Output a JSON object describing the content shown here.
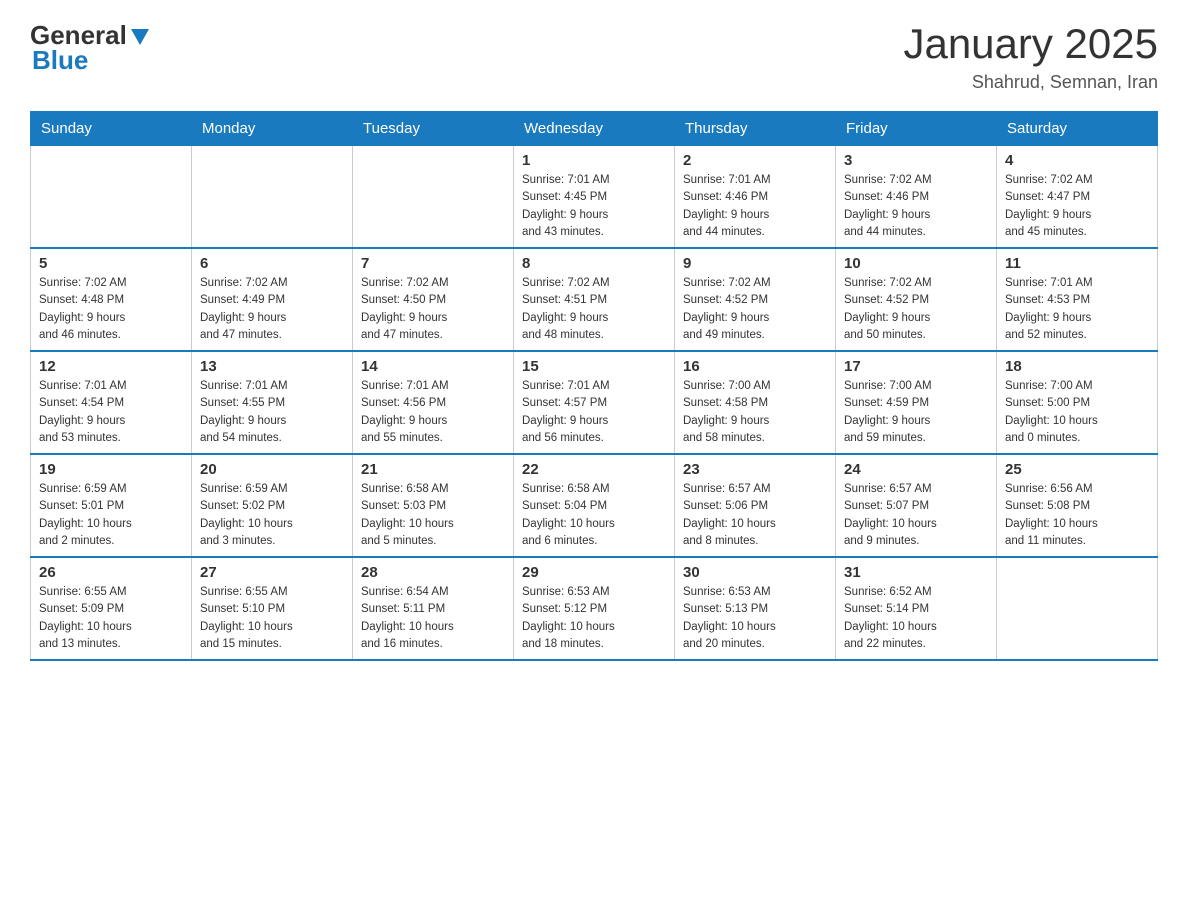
{
  "header": {
    "logo": {
      "general": "General",
      "blue": "Blue"
    },
    "title": "January 2025",
    "subtitle": "Shahrud, Semnan, Iran"
  },
  "days_of_week": [
    "Sunday",
    "Monday",
    "Tuesday",
    "Wednesday",
    "Thursday",
    "Friday",
    "Saturday"
  ],
  "weeks": [
    [
      {
        "day": "",
        "info": ""
      },
      {
        "day": "",
        "info": ""
      },
      {
        "day": "",
        "info": ""
      },
      {
        "day": "1",
        "info": "Sunrise: 7:01 AM\nSunset: 4:45 PM\nDaylight: 9 hours\nand 43 minutes."
      },
      {
        "day": "2",
        "info": "Sunrise: 7:01 AM\nSunset: 4:46 PM\nDaylight: 9 hours\nand 44 minutes."
      },
      {
        "day": "3",
        "info": "Sunrise: 7:02 AM\nSunset: 4:46 PM\nDaylight: 9 hours\nand 44 minutes."
      },
      {
        "day": "4",
        "info": "Sunrise: 7:02 AM\nSunset: 4:47 PM\nDaylight: 9 hours\nand 45 minutes."
      }
    ],
    [
      {
        "day": "5",
        "info": "Sunrise: 7:02 AM\nSunset: 4:48 PM\nDaylight: 9 hours\nand 46 minutes."
      },
      {
        "day": "6",
        "info": "Sunrise: 7:02 AM\nSunset: 4:49 PM\nDaylight: 9 hours\nand 47 minutes."
      },
      {
        "day": "7",
        "info": "Sunrise: 7:02 AM\nSunset: 4:50 PM\nDaylight: 9 hours\nand 47 minutes."
      },
      {
        "day": "8",
        "info": "Sunrise: 7:02 AM\nSunset: 4:51 PM\nDaylight: 9 hours\nand 48 minutes."
      },
      {
        "day": "9",
        "info": "Sunrise: 7:02 AM\nSunset: 4:52 PM\nDaylight: 9 hours\nand 49 minutes."
      },
      {
        "day": "10",
        "info": "Sunrise: 7:02 AM\nSunset: 4:52 PM\nDaylight: 9 hours\nand 50 minutes."
      },
      {
        "day": "11",
        "info": "Sunrise: 7:01 AM\nSunset: 4:53 PM\nDaylight: 9 hours\nand 52 minutes."
      }
    ],
    [
      {
        "day": "12",
        "info": "Sunrise: 7:01 AM\nSunset: 4:54 PM\nDaylight: 9 hours\nand 53 minutes."
      },
      {
        "day": "13",
        "info": "Sunrise: 7:01 AM\nSunset: 4:55 PM\nDaylight: 9 hours\nand 54 minutes."
      },
      {
        "day": "14",
        "info": "Sunrise: 7:01 AM\nSunset: 4:56 PM\nDaylight: 9 hours\nand 55 minutes."
      },
      {
        "day": "15",
        "info": "Sunrise: 7:01 AM\nSunset: 4:57 PM\nDaylight: 9 hours\nand 56 minutes."
      },
      {
        "day": "16",
        "info": "Sunrise: 7:00 AM\nSunset: 4:58 PM\nDaylight: 9 hours\nand 58 minutes."
      },
      {
        "day": "17",
        "info": "Sunrise: 7:00 AM\nSunset: 4:59 PM\nDaylight: 9 hours\nand 59 minutes."
      },
      {
        "day": "18",
        "info": "Sunrise: 7:00 AM\nSunset: 5:00 PM\nDaylight: 10 hours\nand 0 minutes."
      }
    ],
    [
      {
        "day": "19",
        "info": "Sunrise: 6:59 AM\nSunset: 5:01 PM\nDaylight: 10 hours\nand 2 minutes."
      },
      {
        "day": "20",
        "info": "Sunrise: 6:59 AM\nSunset: 5:02 PM\nDaylight: 10 hours\nand 3 minutes."
      },
      {
        "day": "21",
        "info": "Sunrise: 6:58 AM\nSunset: 5:03 PM\nDaylight: 10 hours\nand 5 minutes."
      },
      {
        "day": "22",
        "info": "Sunrise: 6:58 AM\nSunset: 5:04 PM\nDaylight: 10 hours\nand 6 minutes."
      },
      {
        "day": "23",
        "info": "Sunrise: 6:57 AM\nSunset: 5:06 PM\nDaylight: 10 hours\nand 8 minutes."
      },
      {
        "day": "24",
        "info": "Sunrise: 6:57 AM\nSunset: 5:07 PM\nDaylight: 10 hours\nand 9 minutes."
      },
      {
        "day": "25",
        "info": "Sunrise: 6:56 AM\nSunset: 5:08 PM\nDaylight: 10 hours\nand 11 minutes."
      }
    ],
    [
      {
        "day": "26",
        "info": "Sunrise: 6:55 AM\nSunset: 5:09 PM\nDaylight: 10 hours\nand 13 minutes."
      },
      {
        "day": "27",
        "info": "Sunrise: 6:55 AM\nSunset: 5:10 PM\nDaylight: 10 hours\nand 15 minutes."
      },
      {
        "day": "28",
        "info": "Sunrise: 6:54 AM\nSunset: 5:11 PM\nDaylight: 10 hours\nand 16 minutes."
      },
      {
        "day": "29",
        "info": "Sunrise: 6:53 AM\nSunset: 5:12 PM\nDaylight: 10 hours\nand 18 minutes."
      },
      {
        "day": "30",
        "info": "Sunrise: 6:53 AM\nSunset: 5:13 PM\nDaylight: 10 hours\nand 20 minutes."
      },
      {
        "day": "31",
        "info": "Sunrise: 6:52 AM\nSunset: 5:14 PM\nDaylight: 10 hours\nand 22 minutes."
      },
      {
        "day": "",
        "info": ""
      }
    ]
  ]
}
